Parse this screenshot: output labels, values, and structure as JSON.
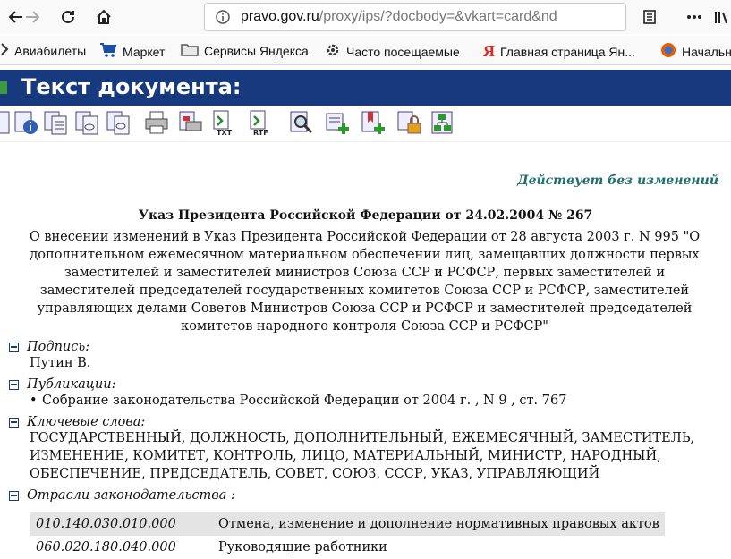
{
  "browser": {
    "url_host": "pravo.gov.ru",
    "url_rest": "/proxy/ips/?docbody=&vkart=card&nd",
    "bookmarks": [
      {
        "label": "Авиабилеты",
        "icon": "airplane-icon"
      },
      {
        "label": "Маркет",
        "icon": "cart-icon"
      },
      {
        "label": "Сервисы Яндекса",
        "icon": "folder-icon"
      },
      {
        "label": "Часто посещаемые",
        "icon": "gear-icon"
      },
      {
        "label": "Главная страница Ян...",
        "icon": "yandex-icon"
      },
      {
        "label": "Начальн",
        "icon": "firefox-icon"
      }
    ]
  },
  "header": {
    "title": "Текст документа:"
  },
  "document": {
    "status": "Действует без изменений",
    "name": "Указ Президента Российской Федерации от 24.02.2004 № 267",
    "subtitle": "О внесении изменений в Указ Президента Российской Федерации от 28 августа 2003 г. N 995 \"О дополнительном ежемесячном материальном обеспечении лиц, замещавших должности первых заместителей и заместителей министров Союза ССР и РСФСР, первых заместителей и заместителей председателей государственных комитетов Союза ССР и РСФСР, заместителей управляющих делами Советов Министров Союза ССР и РСФСР и заместителей председателей комитетов народного контроля Союза ССР и РСФСР\"",
    "sections": {
      "signature": {
        "label": "Подпись:",
        "value": "Путин В."
      },
      "publications": {
        "label": "Публикации:",
        "items": [
          "Собрание законодательства Российской Федерации от 2004 г. , N 9 , ст. 767"
        ]
      },
      "keywords": {
        "label": "Ключевые слова:",
        "value": "ГОСУДАРСТВЕННЫЙ, ДОЛЖНОСТЬ, ДОПОЛНИТЕЛЬНЫЙ, ЕЖЕМЕСЯЧНЫЙ, ЗАМЕСТИТЕЛЬ, ИЗМЕНЕНИЕ, КОМИТЕТ, КОНТРОЛЬ, ЛИЦО, МАТЕРИАЛЬНЫЙ, МИНИСТР, НАРОДНЫЙ, ОБЕСПЕЧЕНИЕ, ПРЕДСЕДАТЕЛЬ, СОВЕТ, СОЮЗ, СССР, УКАЗ, УПРАВЛЯЮЩИЙ"
      },
      "branches": {
        "label": "Отрасли законодательства :",
        "rows": [
          {
            "code": "010.140.030.010.000",
            "name": "Отмена, изменение и дополнение нормативных правовых актов"
          },
          {
            "code": "060.020.180.040.000",
            "name": "Руководящие работники"
          }
        ]
      }
    }
  },
  "colors": {
    "header_bg": "#173a7f",
    "status_text": "#1d6f70",
    "row_shade": "#e4e4e4"
  }
}
